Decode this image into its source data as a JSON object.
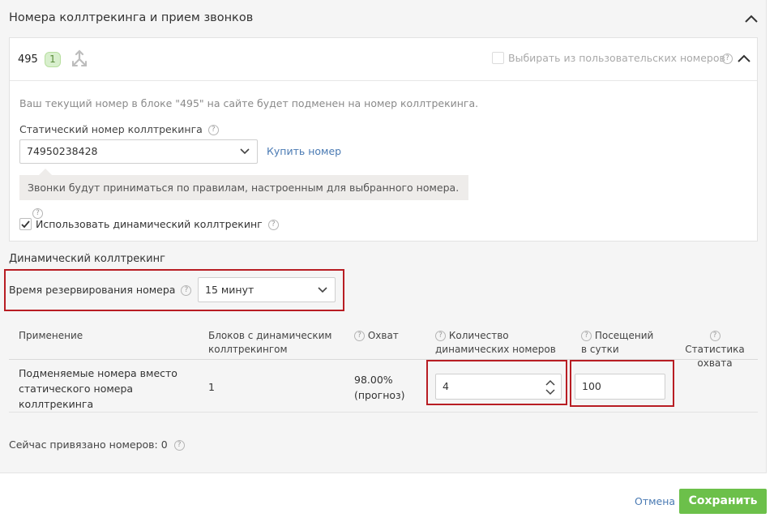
{
  "panel": {
    "title": "Номера коллтрекинга и прием звонков"
  },
  "block": {
    "name": "495",
    "badge": "1",
    "custom_numbers_label": "Выбирать из пользовательских номеров",
    "info_text": "Ваш текущий номер в блоке \"495\" на сайте будет подменен на номер коллтрекинга.",
    "static_label": "Статический номер коллтрекинга",
    "static_value": "74950238428",
    "buy_link": "Купить номер",
    "hint": "Звонки будут приниматься по правилам, настроенным для выбранного номера.",
    "dynamic_checkbox_label": "Использовать динамический коллтрекинг",
    "dynamic_checked": true
  },
  "dynamic": {
    "title": "Динамический коллтрекинг",
    "reserve_label": "Время резервирования номера",
    "reserve_value": "15 минут"
  },
  "table": {
    "headers": {
      "application": "Применение",
      "blocks_l1": "Блоков с динамическим",
      "blocks_l2": "коллтрекингом",
      "coverage": "Охват",
      "count_l1": "Количество",
      "count_l2": "динамических номеров",
      "visits_l1": "Посещений",
      "visits_l2": "в сутки",
      "stats_l1": "Статистика",
      "stats_l2": "охвата"
    },
    "row": {
      "application_l1": "Подменяемые номера вместо",
      "application_l2": "статического номера",
      "application_l3": "коллтрекинга",
      "blocks": "1",
      "coverage_l1": "98.00%",
      "coverage_l2": "(прогноз)",
      "count": "4",
      "visits": "100"
    }
  },
  "bound": {
    "text": "Сейчас привязано номеров: 0"
  },
  "actions": {
    "cancel": "Отмена",
    "save": "Сохранить"
  },
  "colors": {
    "accent_green": "#6cc04a",
    "link_blue": "#4a7ab3",
    "highlight_red": "#b81d23"
  }
}
